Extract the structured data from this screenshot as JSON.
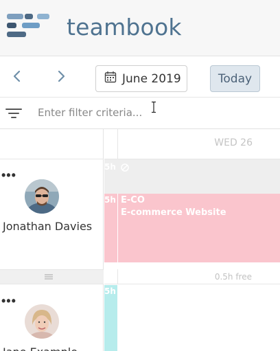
{
  "app": {
    "brand": "teambook",
    "logo_colors": [
      "#4e6a85",
      "#6e9dc5",
      "#3a5068"
    ]
  },
  "toolbar": {
    "prev_icon": "chevron-left-icon",
    "next_icon": "chevron-right-icon",
    "date_label": "June 2019",
    "calendar_icon": "calendar-icon",
    "today_label": "Today"
  },
  "filter": {
    "icon": "filter-icon",
    "placeholder": "Enter filter criteria...",
    "value": ""
  },
  "day": {
    "label": "WED 26"
  },
  "resources": [
    {
      "name": "Jonathan Davies",
      "menu": "•••",
      "unavailable_hours": "5h",
      "booking": {
        "hours": "5h",
        "code": "E-CO",
        "project": "E-commerce Website",
        "color": "#fac5cd"
      },
      "free_text": "0.5h free"
    },
    {
      "name": "Jane Example",
      "menu": "•••",
      "hours": "5h",
      "color": "#b6ecec"
    }
  ],
  "colors": {
    "accent": "#4f7390",
    "today_bg": "#dfe7ee"
  }
}
